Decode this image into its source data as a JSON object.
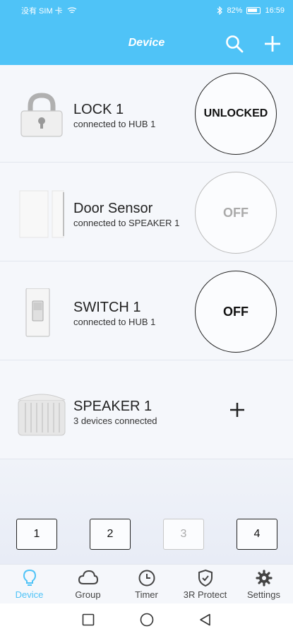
{
  "status": {
    "carrier": "没有 SIM 卡",
    "battery": "82%",
    "time": "16:59"
  },
  "header": {
    "title": "Device"
  },
  "devices": [
    {
      "name": "LOCK 1",
      "subtitle": "connected to HUB 1",
      "action": "UNLOCKED"
    },
    {
      "name": "Door Sensor",
      "subtitle": "connected to SPEAKER 1",
      "action": "OFF"
    },
    {
      "name": "SWITCH 1",
      "subtitle": "connected to HUB 1",
      "action": "OFF"
    },
    {
      "name": "SPEAKER 1",
      "subtitle": "3 devices connected",
      "action": "+"
    }
  ],
  "pages": [
    "1",
    "2",
    "3",
    "4"
  ],
  "tabs": [
    {
      "label": "Device",
      "icon": "bulb-icon"
    },
    {
      "label": "Group",
      "icon": "cloud-icon"
    },
    {
      "label": "Timer",
      "icon": "clock-icon"
    },
    {
      "label": "3R Protect",
      "icon": "shield-icon"
    },
    {
      "label": "Settings",
      "icon": "gear-icon"
    }
  ],
  "colors": {
    "accent": "#4fc3f7",
    "disabled": "#aaaaaa"
  }
}
